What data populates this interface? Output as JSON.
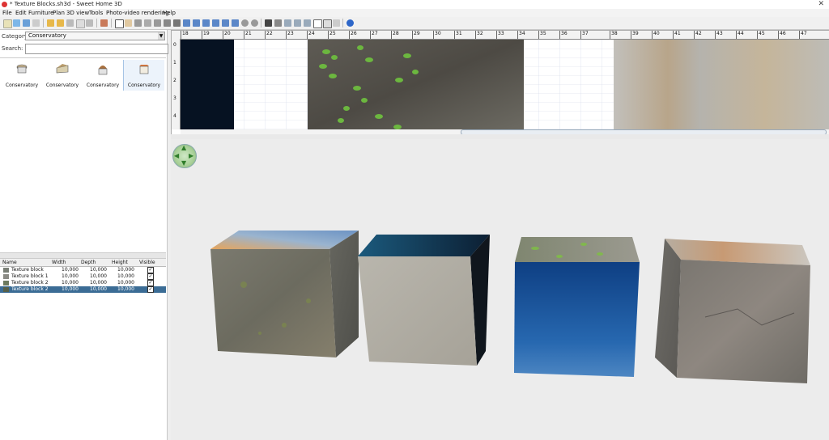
{
  "window": {
    "title": "* Texture Blocks.sh3d - Sweet Home 3D",
    "close_glyph": "✕"
  },
  "menu": [
    "File",
    "Edit",
    "Furniture",
    "Plan",
    "3D view",
    "Tools",
    "Photo-video rendering",
    "Help"
  ],
  "left_panel": {
    "category_label": "Category:",
    "category_value": "Conservatory",
    "search_label": "Search:",
    "search_value": "",
    "catalog_items": [
      {
        "name": "Conservatory",
        "icon": "conservatory-round-icon"
      },
      {
        "name": "Conservatory",
        "icon": "conservatory-lean-icon"
      },
      {
        "name": "Conservatory",
        "icon": "conservatory-dome-icon"
      },
      {
        "name": "Conservatory",
        "icon": "conservatory-square-icon"
      }
    ]
  },
  "furniture_table": {
    "columns": [
      "Name",
      "Width",
      "Depth",
      "Height",
      "Visible"
    ],
    "rows": [
      {
        "name": "Texture block",
        "width": "10,000",
        "depth": "10,000",
        "height": "10,000",
        "visible": true,
        "swatch": "#7a7f76"
      },
      {
        "name": "Texture block 1",
        "width": "10,000",
        "depth": "10,000",
        "height": "10,000",
        "visible": true,
        "swatch": "#8b8b85"
      },
      {
        "name": "Texture block 2",
        "width": "10,000",
        "depth": "10,000",
        "height": "10,000",
        "visible": true,
        "swatch": "#6c7a5e"
      },
      {
        "name": "Texture block 2",
        "width": "10,000",
        "depth": "10,000",
        "height": "10,000",
        "visible": true,
        "swatch": "#55604a"
      }
    ]
  },
  "plan": {
    "ruler_top": [
      "18",
      "19",
      "20",
      "21",
      "22",
      "23",
      "24",
      "25",
      "26",
      "27",
      "28",
      "29",
      "30",
      "31",
      "32",
      "33",
      "34",
      "35",
      "36",
      "37",
      "38",
      "39",
      "40",
      "41",
      "42",
      "43",
      "44",
      "45",
      "46",
      "47"
    ],
    "ruler_left": [
      "0",
      "1",
      "2",
      "3",
      "4",
      "5"
    ]
  },
  "colors": {
    "selection": "#3b6c95",
    "accent": "#2f7d2a"
  }
}
